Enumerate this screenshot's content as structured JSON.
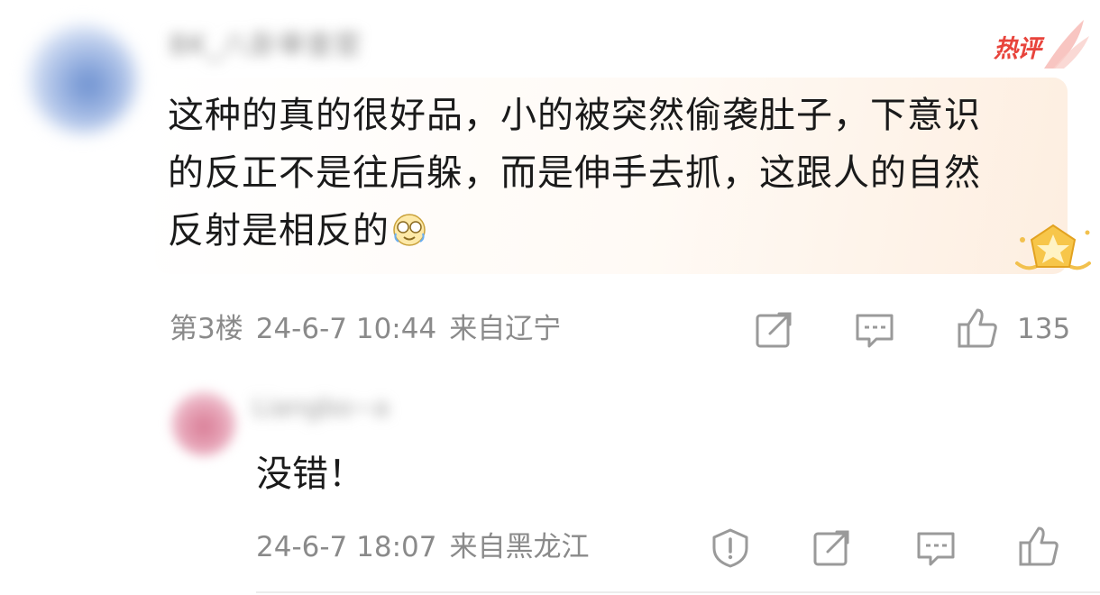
{
  "main_comment": {
    "username": "BK_八卦审查官",
    "hot_label": "热评",
    "text_lines": [
      "这种的真的很好品，小的被突然偷袭肚子，下意识",
      "的反正不是往后躲，而是伸手去抓，这跟人的自然",
      "反射是相反的"
    ],
    "emoji": "laugh-cry-emoji",
    "floor": "第3楼",
    "time": "24-6-7 10:44",
    "location": "来自辽宁",
    "like_count": "135"
  },
  "reply": {
    "username": "Liangbo~a",
    "text": "没错！",
    "time": "24-6-7 18:07",
    "location": "来自黑龙江"
  },
  "colors": {
    "hot": "#e8443c",
    "meta": "#8a8a8a",
    "icon": "#9a9a9a",
    "bubble_end": "#fdeee0"
  },
  "icons": [
    "edit-icon",
    "comment-icon",
    "thumbs-up-icon",
    "report-icon",
    "medal-icon"
  ]
}
